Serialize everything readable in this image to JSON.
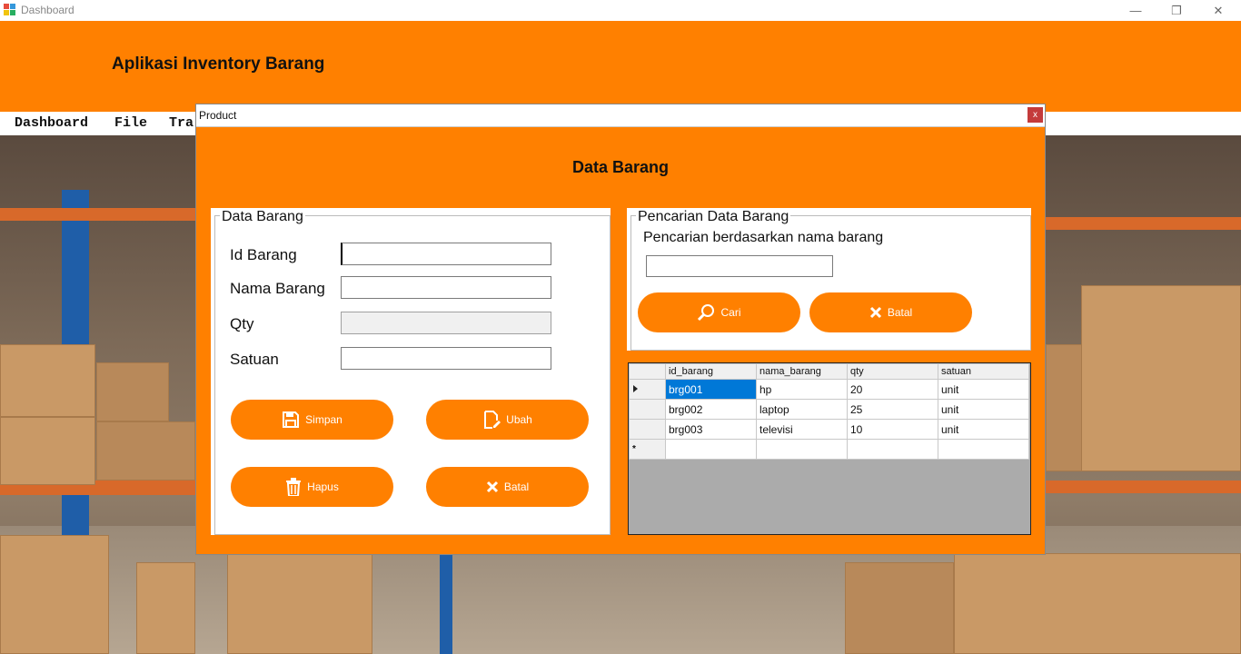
{
  "window": {
    "title": "Dashboard",
    "minimize": "—",
    "maximize": "❐",
    "close": "✕"
  },
  "header": {
    "app_title": "Aplikasi Inventory Barang"
  },
  "menu": {
    "items": [
      "Dashboard",
      "File",
      "Tra"
    ]
  },
  "dialog": {
    "title": "Product",
    "close": "x",
    "heading": "Data Barang",
    "form": {
      "legend": "Data Barang",
      "fields": [
        {
          "label": "Id Barang",
          "value": ""
        },
        {
          "label": "Nama Barang",
          "value": ""
        },
        {
          "label": "Qty",
          "value": ""
        },
        {
          "label": "Satuan",
          "value": ""
        }
      ],
      "buttons": {
        "save": "Simpan",
        "edit": "Ubah",
        "delete": "Hapus",
        "cancel": "Batal"
      }
    },
    "search": {
      "legend": "Pencarian Data Barang",
      "label": "Pencarian berdasarkan nama barang",
      "value": "",
      "buttons": {
        "search": "Cari",
        "cancel": "Batal"
      }
    },
    "grid": {
      "columns": [
        "id_barang",
        "nama_barang",
        "qty",
        "satuan"
      ],
      "rows": [
        [
          "brg001",
          "hp",
          "20",
          "unit"
        ],
        [
          "brg002",
          "laptop",
          "25",
          "unit"
        ],
        [
          "brg003",
          "televisi",
          "10",
          "unit"
        ]
      ],
      "new_row_marker": "*"
    }
  }
}
